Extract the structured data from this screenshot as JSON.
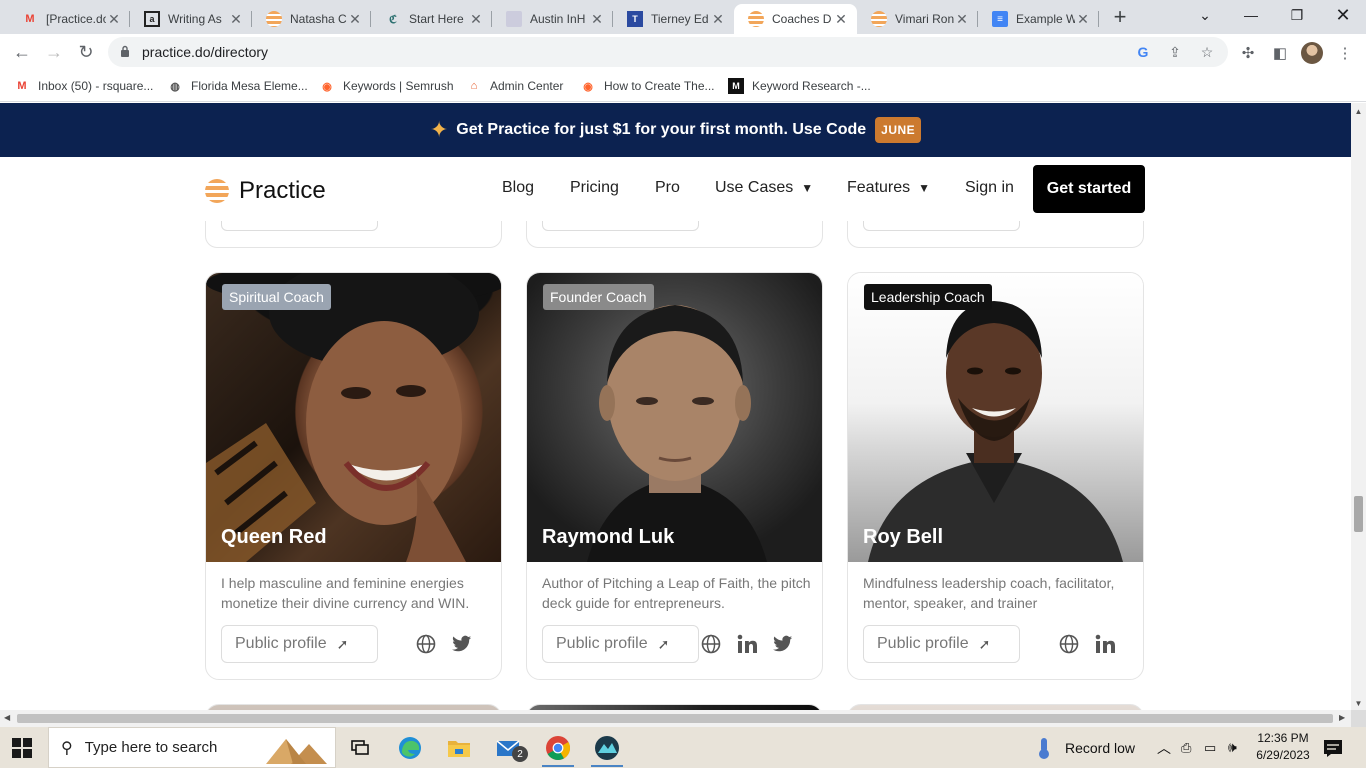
{
  "browser": {
    "tabs": [
      {
        "title": "[Practice.do",
        "icon": "gmail-icon",
        "active": false
      },
      {
        "title": "Writing As",
        "icon": "writing-icon",
        "active": false
      },
      {
        "title": "Natasha Co",
        "icon": "practice-icon",
        "active": false
      },
      {
        "title": "Start Here",
        "icon": "start-icon",
        "active": false
      },
      {
        "title": "Austin InH",
        "icon": "austin-icon",
        "active": false
      },
      {
        "title": "Tierney Ed",
        "icon": "tierney-icon",
        "active": false
      },
      {
        "title": "Coaches D",
        "icon": "practice-icon",
        "active": true
      },
      {
        "title": "Vimari Ron",
        "icon": "practice-icon",
        "active": false
      },
      {
        "title": "Example W",
        "icon": "docs-icon",
        "active": false
      }
    ],
    "url": "practice.do/directory",
    "bookmarks": [
      {
        "label": "Inbox (50) - rsquare...",
        "icon": "gmail-icon"
      },
      {
        "label": "Florida Mesa Eleme...",
        "icon": "globe-icon"
      },
      {
        "label": "Keywords | Semrush",
        "icon": "semrush-icon"
      },
      {
        "label": "Admin Center",
        "icon": "admin-icon"
      },
      {
        "label": "How to Create The...",
        "icon": "semrush-icon"
      },
      {
        "label": "Keyword Research -...",
        "icon": "medium-icon"
      }
    ]
  },
  "promo": {
    "text": "Get Practice for just $1 for your first month. Use Code",
    "code": "JUNE"
  },
  "site_nav": {
    "brand": "Practice",
    "links": [
      "Blog",
      "Pricing",
      "Pro",
      "Use Cases",
      "Features",
      "Sign in"
    ],
    "cta": "Get started"
  },
  "coaches": [
    {
      "badge": "Spiritual Coach",
      "badge_color": "#9aa4b1",
      "name": "Queen Red",
      "description": "I help masculine and feminine energies monetize their divine currency and WIN.",
      "profile_label": "Public profile",
      "socials": [
        "globe-icon",
        "twitter-icon"
      ]
    },
    {
      "badge": "Founder Coach",
      "badge_color": "#8a8a8a",
      "name": "Raymond Luk",
      "description": "Author of Pitching a Leap of Faith, the pitch deck guide for entrepreneurs.",
      "profile_label": "Public profile",
      "socials": [
        "globe-icon",
        "linkedin-icon",
        "twitter-icon"
      ]
    },
    {
      "badge": "Leadership Coach",
      "badge_color": "#111111",
      "name": "Roy Bell",
      "description": "Mindfulness leadership coach, facilitator, mentor, speaker, and trainer",
      "profile_label": "Public profile",
      "socials": [
        "globe-icon",
        "linkedin-icon"
      ]
    }
  ],
  "taskbar": {
    "search_placeholder": "Type here to search",
    "mail_badge": "2",
    "weather": "Record low",
    "time": "12:36 PM",
    "date": "6/29/2023"
  },
  "colors": {
    "promo_bg": "#0c2250",
    "promo_code_bg": "#cc7a2f",
    "brand_orange": "#f2a65a"
  }
}
